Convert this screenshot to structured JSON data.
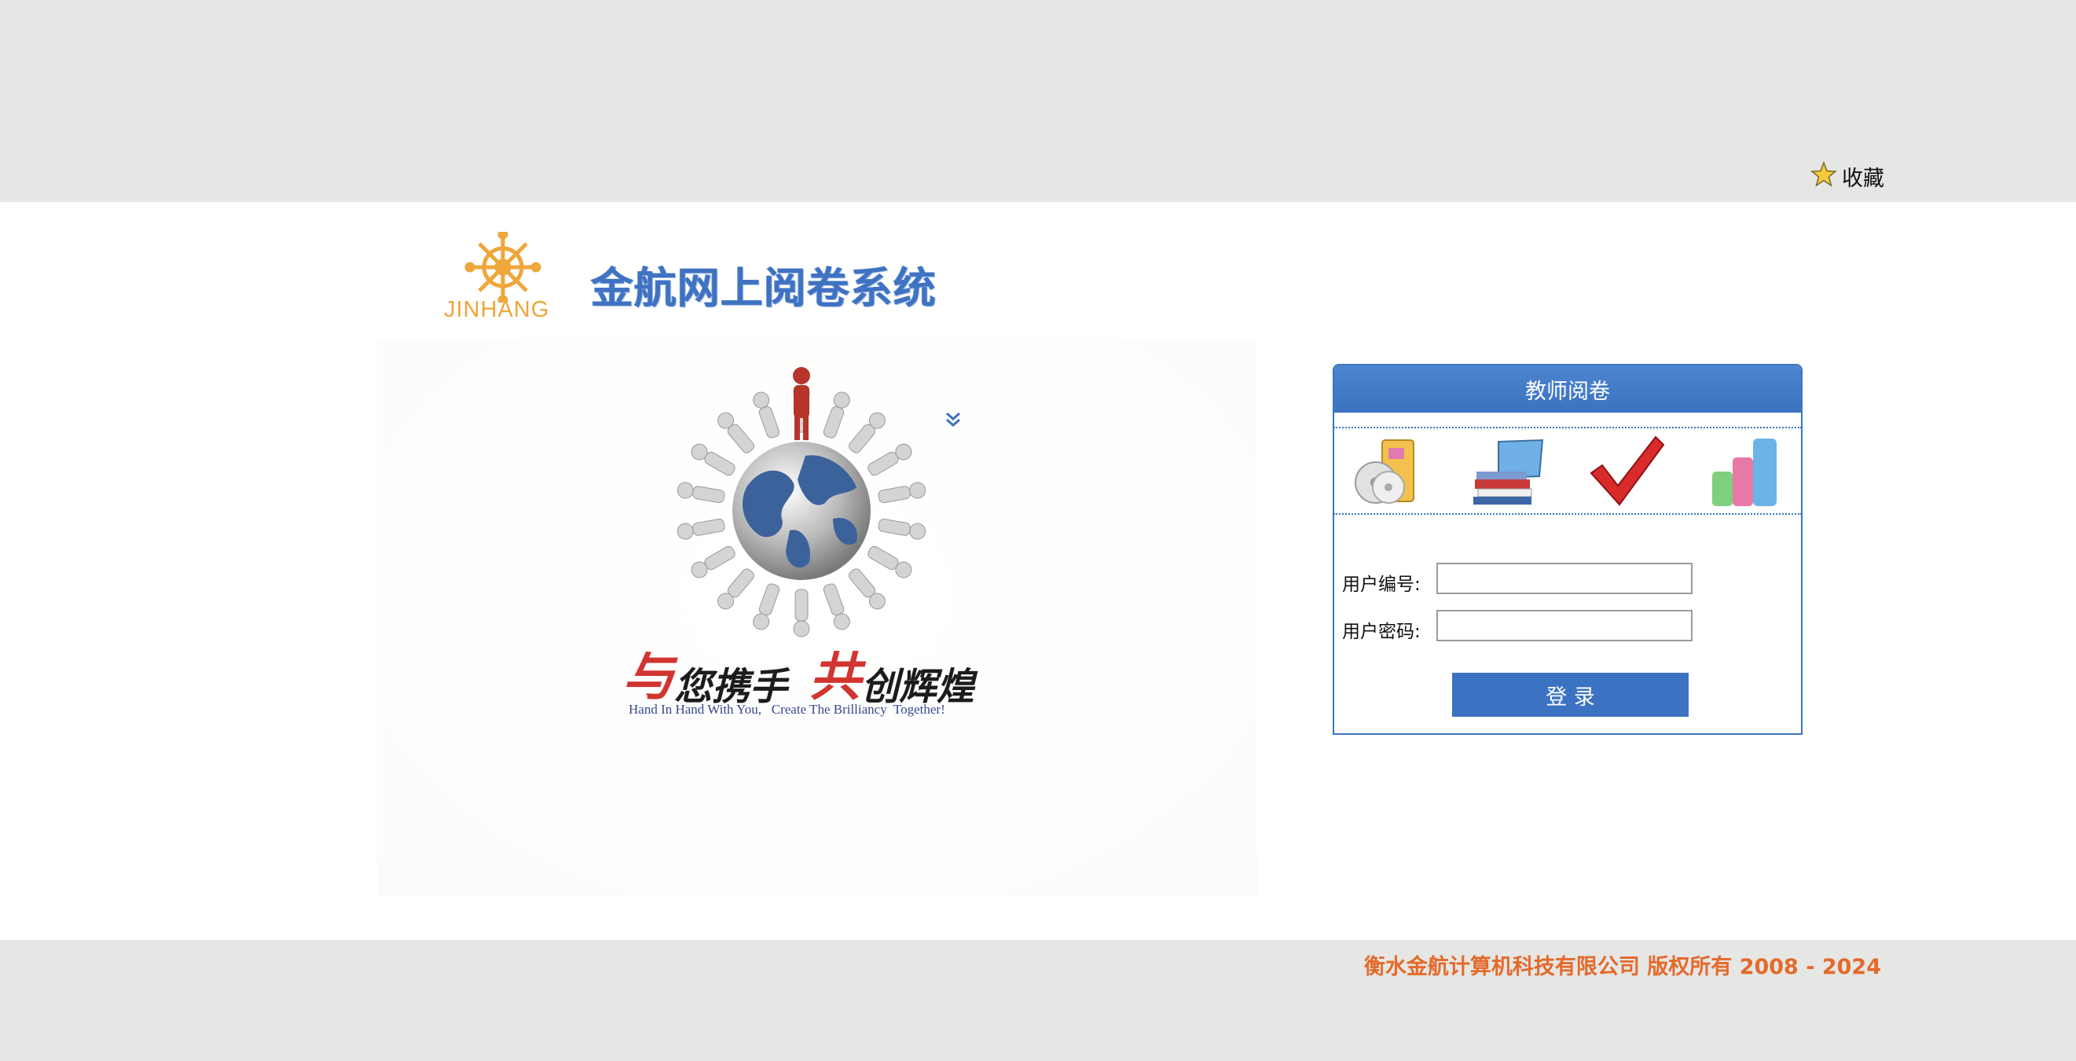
{
  "header": {
    "favorite_label": "收藏",
    "favorite_icon": "star-icon"
  },
  "brand": {
    "logo_text": "JINHANG",
    "system_title": "金航网上阅卷系统",
    "logo_icon": "ship-wheel-icon"
  },
  "hero": {
    "slogan_part1_red": "与",
    "slogan_part1_black": "您携手",
    "slogan_part2_red": "共",
    "slogan_part2_black": "创辉煌",
    "slogan_en": "Hand In Hand With You,   Create The Brilliancy  Together!"
  },
  "login": {
    "title": "教师阅卷",
    "user_id_label": "用户编号:",
    "user_id_value": "",
    "password_label": "用户密码:",
    "password_value": "",
    "submit_label": "登      录",
    "icons": [
      "disc-book-icon",
      "books-laptop-icon",
      "checkmark-icon",
      "bar-chart-icon"
    ]
  },
  "footer": {
    "copyright": "衡水金航计算机科技有限公司 版权所有 2008 - 2024"
  },
  "colors": {
    "primary_blue": "#3b72c1",
    "gray_band": "#e6e6e5",
    "copyright_orange": "#e46a2a"
  }
}
